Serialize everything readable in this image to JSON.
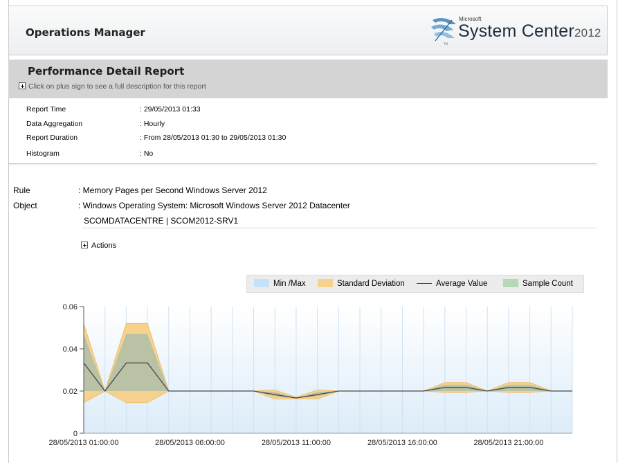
{
  "header": {
    "app_title": "Operations Manager",
    "brand_small": "Microsoft",
    "brand_main": "System Center",
    "brand_year": "2012",
    "brand_mark": "TM"
  },
  "report": {
    "title": "Performance Detail Report",
    "description_hint": "Click on plus sign to see a full description for this report"
  },
  "parameters": [
    {
      "label": "Report Time",
      "value": ": 29/05/2013 01:33"
    },
    {
      "label": "Data Aggregation",
      "value": ": Hourly"
    },
    {
      "label": "Report Duration",
      "value": ": From  28/05/2013 01:30  to  29/05/2013 01:30"
    },
    {
      "label": "Histogram",
      "value": ": No"
    }
  ],
  "details": {
    "rule_label": "Rule",
    "rule_value": ": Memory Pages per Second Windows Server 2012",
    "object_label": "Object",
    "object_value": ": Windows Operating System: Microsoft Windows Server 2012 Datacenter",
    "object_value_line2": "SCOMDATACENTRE | SCOM2012-SRV1"
  },
  "actions_label": "Actions",
  "legend": [
    {
      "name": "Min /Max",
      "color": "#c7e2f7",
      "kind": "area"
    },
    {
      "name": "Standard Deviation",
      "color": "#f7d28f",
      "kind": "area"
    },
    {
      "name": "Average Value",
      "color": "#333333",
      "kind": "line"
    },
    {
      "name": "Sample Count",
      "color": "#b4d9b4",
      "kind": "area"
    }
  ],
  "chart_data": {
    "type": "line",
    "ylim": [
      0,
      0.06
    ],
    "y_ticks": [
      "0",
      "0.02",
      "0.04",
      "0.06"
    ],
    "y_tick_values": [
      0,
      0.02,
      0.04,
      0.06
    ],
    "x_tick_labels": [
      "28/05/2013 01:00:00",
      "28/05/2013 06:00:00",
      "28/05/2013 11:00:00",
      "28/05/2013 16:00:00",
      "28/05/2013 21:00:00"
    ],
    "x_tick_hours": [
      0,
      5,
      10,
      15,
      20
    ],
    "hours": [
      0,
      1,
      2,
      3,
      4,
      5,
      6,
      7,
      8,
      9,
      10,
      11,
      12,
      13,
      14,
      15,
      16,
      17,
      18,
      19,
      20,
      21,
      22,
      23
    ],
    "x_domain": [
      0,
      23
    ],
    "series": [
      {
        "name": "Average Value",
        "values": [
          0.0333,
          0.02,
          0.0333,
          0.0333,
          0.02,
          0.02,
          0.02,
          0.02,
          0.02,
          0.0183,
          0.0167,
          0.0183,
          0.02,
          0.02,
          0.02,
          0.02,
          0.02,
          0.0217,
          0.0217,
          0.02,
          0.0217,
          0.0217,
          0.02,
          0.02
        ]
      },
      {
        "name": "Standard Deviation Upper",
        "values": [
          0.052,
          0.02,
          0.052,
          0.052,
          0.02,
          0.02,
          0.02,
          0.02,
          0.02,
          0.0205,
          0.017,
          0.0205,
          0.02,
          0.02,
          0.02,
          0.02,
          0.02,
          0.024,
          0.024,
          0.02,
          0.024,
          0.024,
          0.02,
          0.02
        ]
      },
      {
        "name": "Standard Deviation Lower",
        "values": [
          0.0145,
          0.02,
          0.0145,
          0.0145,
          0.02,
          0.02,
          0.02,
          0.02,
          0.02,
          0.0162,
          0.0163,
          0.0162,
          0.02,
          0.02,
          0.02,
          0.02,
          0.02,
          0.0193,
          0.0193,
          0.02,
          0.0193,
          0.0193,
          0.02,
          0.02
        ]
      },
      {
        "name": "Min Max Upper",
        "values": [
          0.047,
          0.02,
          0.047,
          0.047,
          0.02,
          0.02,
          0.02,
          0.02,
          0.02,
          0.0195,
          0.0167,
          0.0195,
          0.02,
          0.02,
          0.02,
          0.02,
          0.02,
          0.023,
          0.023,
          0.02,
          0.023,
          0.023,
          0.02,
          0.02
        ]
      },
      {
        "name": "Min Max Lower",
        "values": [
          0.02,
          0.02,
          0.02,
          0.02,
          0.02,
          0.02,
          0.02,
          0.02,
          0.02,
          0.0175,
          0.0167,
          0.0175,
          0.02,
          0.02,
          0.02,
          0.02,
          0.02,
          0.02,
          0.02,
          0.02,
          0.02,
          0.02,
          0.02,
          0.02
        ]
      }
    ],
    "colors": {
      "plot_bg_top": "#ffffff",
      "plot_bg_bottom": "#dcecf9",
      "std_dev": "#f7d28f",
      "min_max": "#b9c2a4",
      "avg": "#4a4a4a",
      "grid": "#cfe1f1"
    }
  }
}
